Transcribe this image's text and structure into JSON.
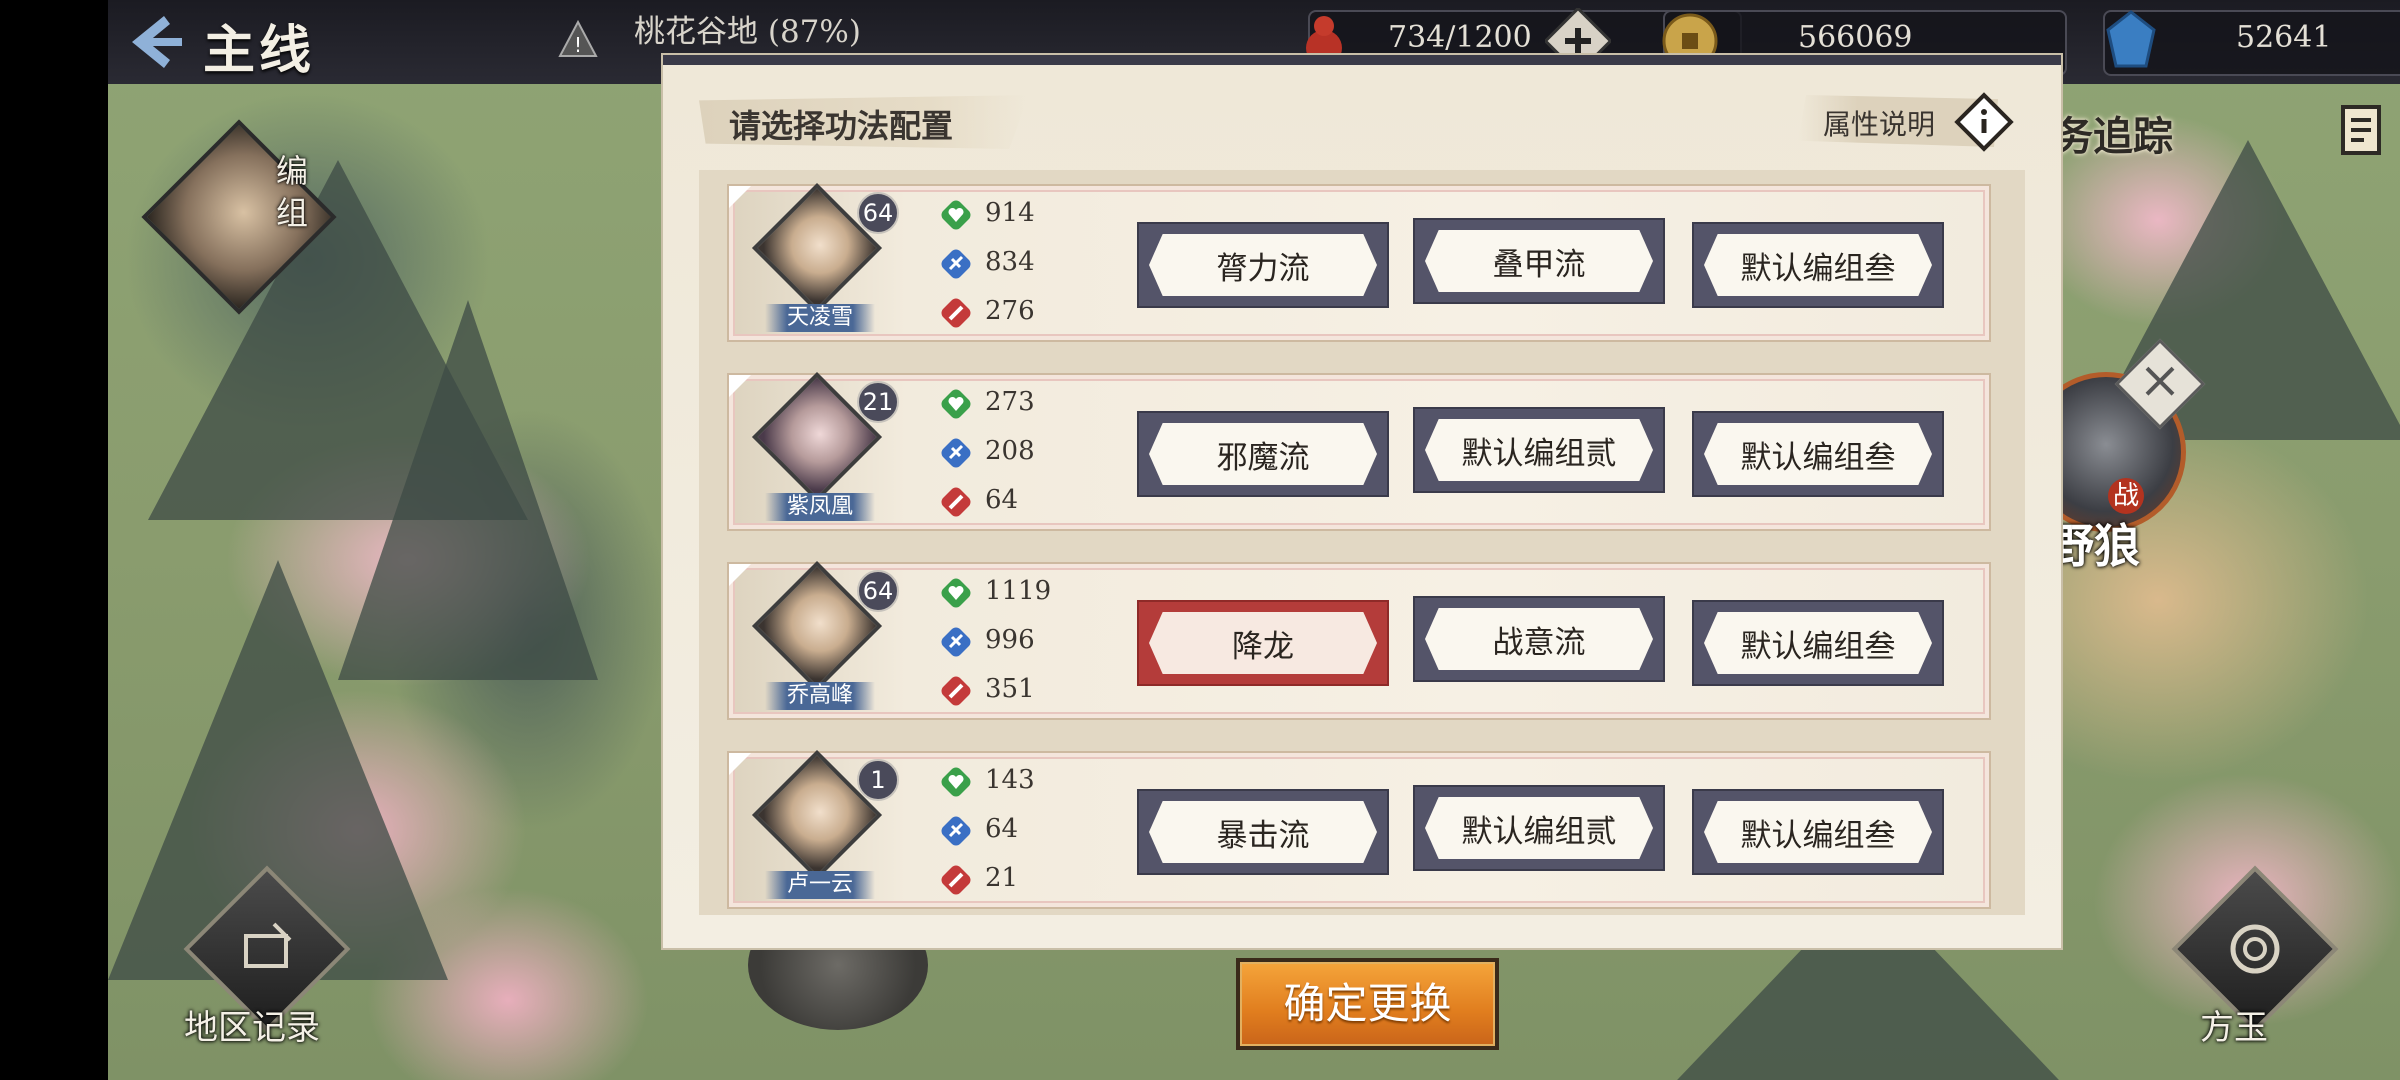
{
  "header": {
    "title": "主线",
    "location": "桃花谷地 (87%)",
    "stamina": "734/1200",
    "coins": "566069",
    "gems": "52641"
  },
  "left_panel": {
    "team_label": "编组",
    "region_record_label": "地区记录"
  },
  "right_panel": {
    "quest_track_label": "任务追踪",
    "enemy_name": "野狼",
    "enemy_tag": "战",
    "fangyu_label": "方玉"
  },
  "dialog": {
    "title": "请选择功法配置",
    "attr_help_label": "属性说明",
    "characters": [
      {
        "name": "天凌雪",
        "level": "64",
        "stats": [
          "914",
          "834",
          "276"
        ],
        "options": [
          "膂力流",
          "叠甲流",
          "默认编组叁"
        ],
        "selected": -1
      },
      {
        "name": "紫凤凰",
        "level": "21",
        "stats": [
          "273",
          "208",
          "64"
        ],
        "options": [
          "邪魔流",
          "默认编组贰",
          "默认编组叁"
        ],
        "selected": -1
      },
      {
        "name": "乔高峰",
        "level": "64",
        "stats": [
          "1119",
          "996",
          "351"
        ],
        "options": [
          "降龙",
          "战意流",
          "默认编组叁"
        ],
        "selected": 0
      },
      {
        "name": "卢一云",
        "level": "1",
        "stats": [
          "143",
          "64",
          "21"
        ],
        "options": [
          "暴击流",
          "默认编组贰",
          "默认编组叁"
        ],
        "selected": -1
      }
    ]
  },
  "confirm_button": "确定更换",
  "colors": {
    "selected_option": "#b43c3a",
    "option_frame": "#545469",
    "confirm": "#e88a25"
  }
}
